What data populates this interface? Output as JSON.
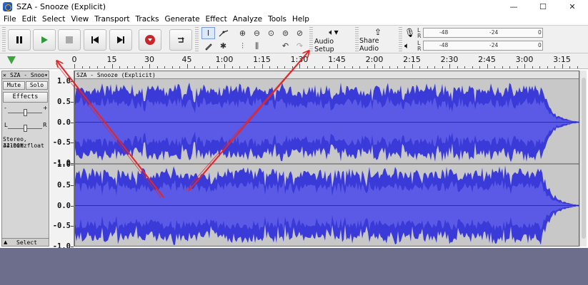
{
  "window": {
    "title": "SZA - Snooze (Explicit)",
    "minimize": "—",
    "maximize": "☐",
    "close": "✕"
  },
  "menu": [
    "File",
    "Edit",
    "Select",
    "View",
    "Transport",
    "Tracks",
    "Generate",
    "Effect",
    "Analyze",
    "Tools",
    "Help"
  ],
  "toolbar": {
    "audio_setup_label": "Audio Setup",
    "share_audio_label": "Share Audio",
    "record_meter_ticks": [
      "-48",
      "-24",
      "0"
    ],
    "playback_meter_ticks": [
      "-48",
      "-24",
      "0"
    ],
    "meter_channels": [
      "L",
      "R"
    ]
  },
  "timeline": {
    "labels": [
      "0",
      "15",
      "30",
      "45",
      "1:00",
      "1:15",
      "1:30",
      "1:45",
      "2:00",
      "2:15",
      "2:30",
      "2:45",
      "3:00",
      "3:15"
    ]
  },
  "track": {
    "name": "SZA - Snoo▾",
    "clip_name": "SZA - Snooze (Explicit)",
    "mute_label": "Mute",
    "solo_label": "Solo",
    "effects_label": "Effects",
    "gain_minus": "-",
    "gain_plus": "+",
    "pan_left": "L",
    "pan_right": "R",
    "info_line1": "Stereo, 44100Hz",
    "info_line2": "32-bit float",
    "select_label": "Select",
    "vertical_scale": [
      "1.0",
      "0.5",
      "0.0",
      "-0.5",
      "-1.0",
      "1.0",
      "0.5",
      "0.0",
      "-0.5",
      "-1.0"
    ]
  },
  "colors": {
    "waveform": "#3a3ad8",
    "waveform_rms": "#5a5ae6",
    "arrow": "#e0262a",
    "empty_area": "#6d6e8c",
    "play_green": "#3aa53a"
  }
}
